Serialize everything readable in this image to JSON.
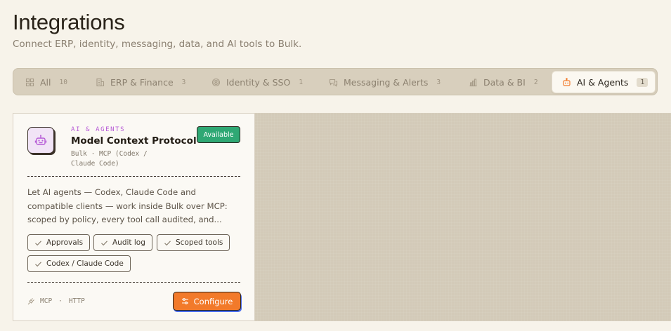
{
  "header": {
    "title": "Integrations",
    "subtitle": "Connect ERP, identity, messaging, data, and AI tools to Bulk."
  },
  "tabs": [
    {
      "label": "All",
      "count": "10",
      "icon": "grid-icon",
      "active": false
    },
    {
      "label": "ERP & Finance",
      "count": "3",
      "icon": "building-icon",
      "active": false
    },
    {
      "label": "Identity & SSO",
      "count": "1",
      "icon": "fingerprint-icon",
      "active": false
    },
    {
      "label": "Messaging & Alerts",
      "count": "3",
      "icon": "chat-icon",
      "active": false
    },
    {
      "label": "Data & BI",
      "count": "2",
      "icon": "bar-chart-icon",
      "active": false
    },
    {
      "label": "AI & Agents",
      "count": "1",
      "icon": "robot-icon",
      "active": true
    }
  ],
  "card": {
    "icon": "robot-icon",
    "category": "AI & AGENTS",
    "name": "Model Context Protocol",
    "meta_line1": "Bulk · MCP (Codex /",
    "meta_line2": "Claude Code)",
    "status": "Available",
    "description": "Let AI agents — Codex, Claude Code and compatible clients — work inside Bulk over MCP: scoped by policy, every tool call audited, and...",
    "features": [
      "Approvals",
      "Audit log",
      "Scoped tools",
      "Codex / Claude Code"
    ],
    "footer": {
      "icon": "plug-icon",
      "protocol": "MCP",
      "separator": "·",
      "transport": "HTTP"
    },
    "configure_label": "Configure",
    "configure_icon": "sliders-icon"
  },
  "colors": {
    "accent_orange": "#f27a2a",
    "status_green": "#2fa874",
    "category_purple": "#b65ad6",
    "background": "#f7f3ea",
    "tabbar": "#d8cfbd"
  }
}
